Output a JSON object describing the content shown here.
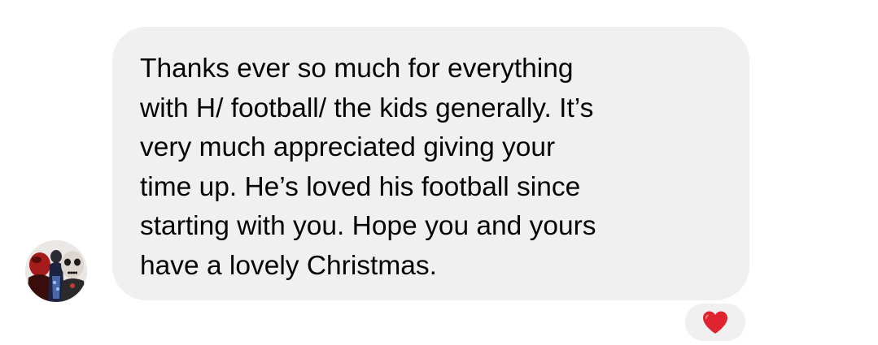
{
  "message": {
    "text": "Thanks ever so much for everything\nwith H/ football/ the kids generally. It’s\nvery much appreciated giving your\ntime up. He’s loved his football since\nstarting with you. Hope you and yours\nhave a lovely Christmas.",
    "bubble_color": "#f0f0f0",
    "text_color": "#050505"
  },
  "sender": {
    "avatar_icon": "profile-photo"
  },
  "reaction": {
    "icon": "red-heart-icon",
    "color": "#e0242f"
  }
}
